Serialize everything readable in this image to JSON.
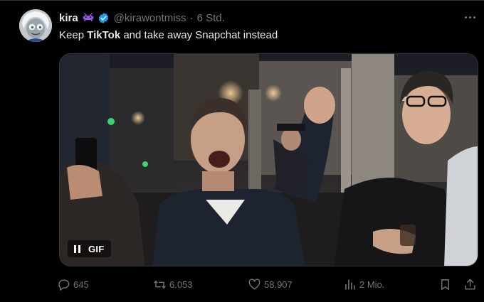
{
  "tweet": {
    "author_name": "kira",
    "handle": "@kirawontmiss",
    "separator": "·",
    "timestamp": "6 Std.",
    "text_before": "Keep ",
    "text_bold": "TikTok",
    "text_after": " and take away Snapchat instead"
  },
  "media": {
    "badge_label": "GIF",
    "icon": "pause-icon"
  },
  "actions": {
    "replies": "645",
    "reposts": "6.053",
    "likes": "58.907",
    "views": "2 Mio."
  },
  "icons": {
    "more": "more-horizontal-icon",
    "emoji": "alien-monster-icon",
    "verified": "verified-badge-icon",
    "reply": "reply-icon",
    "repost": "repost-icon",
    "like": "heart-icon",
    "views": "views-chart-icon",
    "bookmark": "bookmark-icon",
    "share": "share-icon"
  },
  "colors": {
    "background": "#000000",
    "text": "#e7e9ea",
    "muted": "#71767b",
    "verified": "#1d9bf0",
    "emoji": "#8e5cd9"
  }
}
